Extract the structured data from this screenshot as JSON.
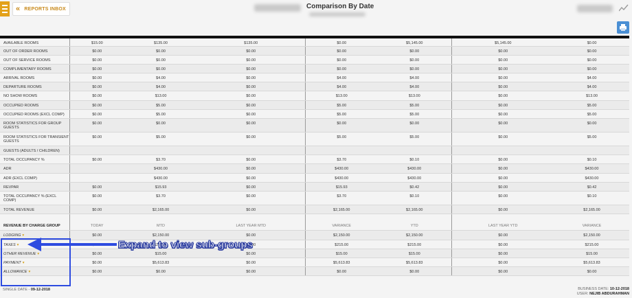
{
  "header": {
    "inbox_label": "REPORTS INBOX",
    "title": "Comparison By Date"
  },
  "columns": [
    "TODAY",
    "MTD",
    "LAST YEAR MTD",
    "VARIANCE",
    "YTD",
    "LAST YEAR YTD",
    "VARIANCE"
  ],
  "stats_rows": [
    {
      "label": "AVAILABLE ROOMS",
      "values": [
        "$15.00",
        "$135.00",
        "$135.00",
        "$0.00",
        "$5,145.00",
        "$5,145.00",
        "$0.00"
      ]
    },
    {
      "label": "OUT OF ORDER ROOMS",
      "values": [
        "$0.00",
        "$0.00",
        "$0.00",
        "$0.00",
        "$0.00",
        "$0.00",
        "$0.00"
      ]
    },
    {
      "label": "OUT OF SERVICE ROOMS",
      "values": [
        "$0.00",
        "$0.00",
        "$0.00",
        "$0.00",
        "$0.00",
        "$0.00",
        "$0.00"
      ]
    },
    {
      "label": "COMPLIMENTARY ROOMS",
      "values": [
        "$0.00",
        "$0.00",
        "$0.00",
        "$0.00",
        "$0.00",
        "$0.00",
        "$0.00"
      ]
    },
    {
      "label": "ARRIVAL ROOMS",
      "values": [
        "$0.00",
        "$4.00",
        "$0.00",
        "$4.00",
        "$4.00",
        "$0.00",
        "$4.00"
      ]
    },
    {
      "label": "DEPARTURE ROOMS",
      "values": [
        "$0.00",
        "$4.00",
        "$0.00",
        "$4.00",
        "$4.00",
        "$0.00",
        "$4.00"
      ]
    },
    {
      "label": "NO SHOW ROOMS",
      "values": [
        "$0.00",
        "$13.00",
        "$0.00",
        "$13.00",
        "$13.00",
        "$0.00",
        "$13.00"
      ]
    },
    {
      "label": "OCCUPIED ROOMS",
      "values": [
        "$0.00",
        "$5.00",
        "$0.00",
        "$5.00",
        "$5.00",
        "$0.00",
        "$5.00"
      ]
    },
    {
      "label": "OCCUPIED ROOMS (EXCL COMP)",
      "values": [
        "$0.00",
        "$5.00",
        "$0.00",
        "$5.00",
        "$5.00",
        "$0.00",
        "$5.00"
      ]
    },
    {
      "label": "ROOM STATISTICS FOR GROUP GUESTS",
      "tall": true,
      "values": [
        "$0.00",
        "$0.00",
        "$0.00",
        "$0.00",
        "$0.00",
        "$0.00",
        "$0.00"
      ]
    },
    {
      "label": "ROOM STATISTICS FOR TRANSIENT GUESTS",
      "tall": true,
      "values": [
        "$0.00",
        "$5.00",
        "$0.00",
        "$5.00",
        "$5.00",
        "$0.00",
        "$5.00"
      ]
    },
    {
      "label": "GUESTS (ADULTS / CHILDREN)",
      "values": [
        "",
        "",
        "",
        "",
        "",
        "",
        ""
      ]
    },
    {
      "label": "TOTAL OCCUPANCY %",
      "values": [
        "$0.00",
        "$3.70",
        "$0.00",
        "$3.70",
        "$0.10",
        "$0.00",
        "$0.10"
      ]
    },
    {
      "label": "ADR",
      "values": [
        "",
        "$430.00",
        "$0.00",
        "$430.00",
        "$430.00",
        "$0.00",
        "$430.00"
      ]
    },
    {
      "label": "ADR (EXCL COMP)",
      "values": [
        "",
        "$430.00",
        "$0.00",
        "$430.00",
        "$430.00",
        "$0.00",
        "$430.00"
      ]
    },
    {
      "label": "REVPAR",
      "values": [
        "$0.00",
        "$15.93",
        "$0.00",
        "$15.93",
        "$0.42",
        "$0.00",
        "$0.42"
      ]
    },
    {
      "label": "TOTAL OCCUPANCY % (EXCL COMP)",
      "tall": true,
      "values": [
        "$0.00",
        "$3.70",
        "$0.00",
        "$3.70",
        "$0.10",
        "$0.00",
        "$0.10"
      ]
    },
    {
      "label": "TOTAL REVENUE",
      "values": [
        "$0.00",
        "$2,165.00",
        "$0.00",
        "$2,165.00",
        "$2,165.00",
        "$0.00",
        "$2,165.00"
      ]
    }
  ],
  "revenue_header": "REVENUE BY CHARGE GROUP",
  "revenue_rows": [
    {
      "label": "LODGING",
      "values": [
        "$0.00",
        "$2,150.00",
        "$0.00",
        "$2,150.00",
        "$2,150.00",
        "$0.00",
        "$2,150.00"
      ]
    },
    {
      "label": "TAXES",
      "values": [
        "$0.00",
        "$215.00",
        "$0.00",
        "$215.00",
        "$215.00",
        "$0.00",
        "$215.00"
      ]
    },
    {
      "label": "OTHER REVENUE",
      "values": [
        "$0.00",
        "$15.00",
        "$0.00",
        "$15.00",
        "$15.00",
        "$0.00",
        "$15.00"
      ]
    },
    {
      "label": "PAYMENT",
      "values": [
        "$0.00",
        "$5,613.83",
        "$0.00",
        "$5,613.83",
        "$5,613.83",
        "$0.00",
        "$5,613.83"
      ]
    },
    {
      "label": "ALLOWANCE",
      "values": [
        "$0.00",
        "$0.00",
        "$0.00",
        "$0.00",
        "$0.00",
        "$0.00",
        "$0.00"
      ]
    }
  ],
  "expand_glyph": "▾",
  "annotation": {
    "callout": "Expand to view sub-groups",
    "color": "#2d4be0"
  },
  "footer": {
    "single_date_label": "SINGLE DATE -",
    "single_date_value": "09-12-2018",
    "business_date_label": "BUSINESS DATE:",
    "business_date_value": "10-12-2018",
    "user_label": "USER:",
    "user_value": "NEJIB ABDURAHMAN"
  },
  "colors": {
    "accent": "#e3a11b",
    "print_button": "#4a8fd4"
  }
}
